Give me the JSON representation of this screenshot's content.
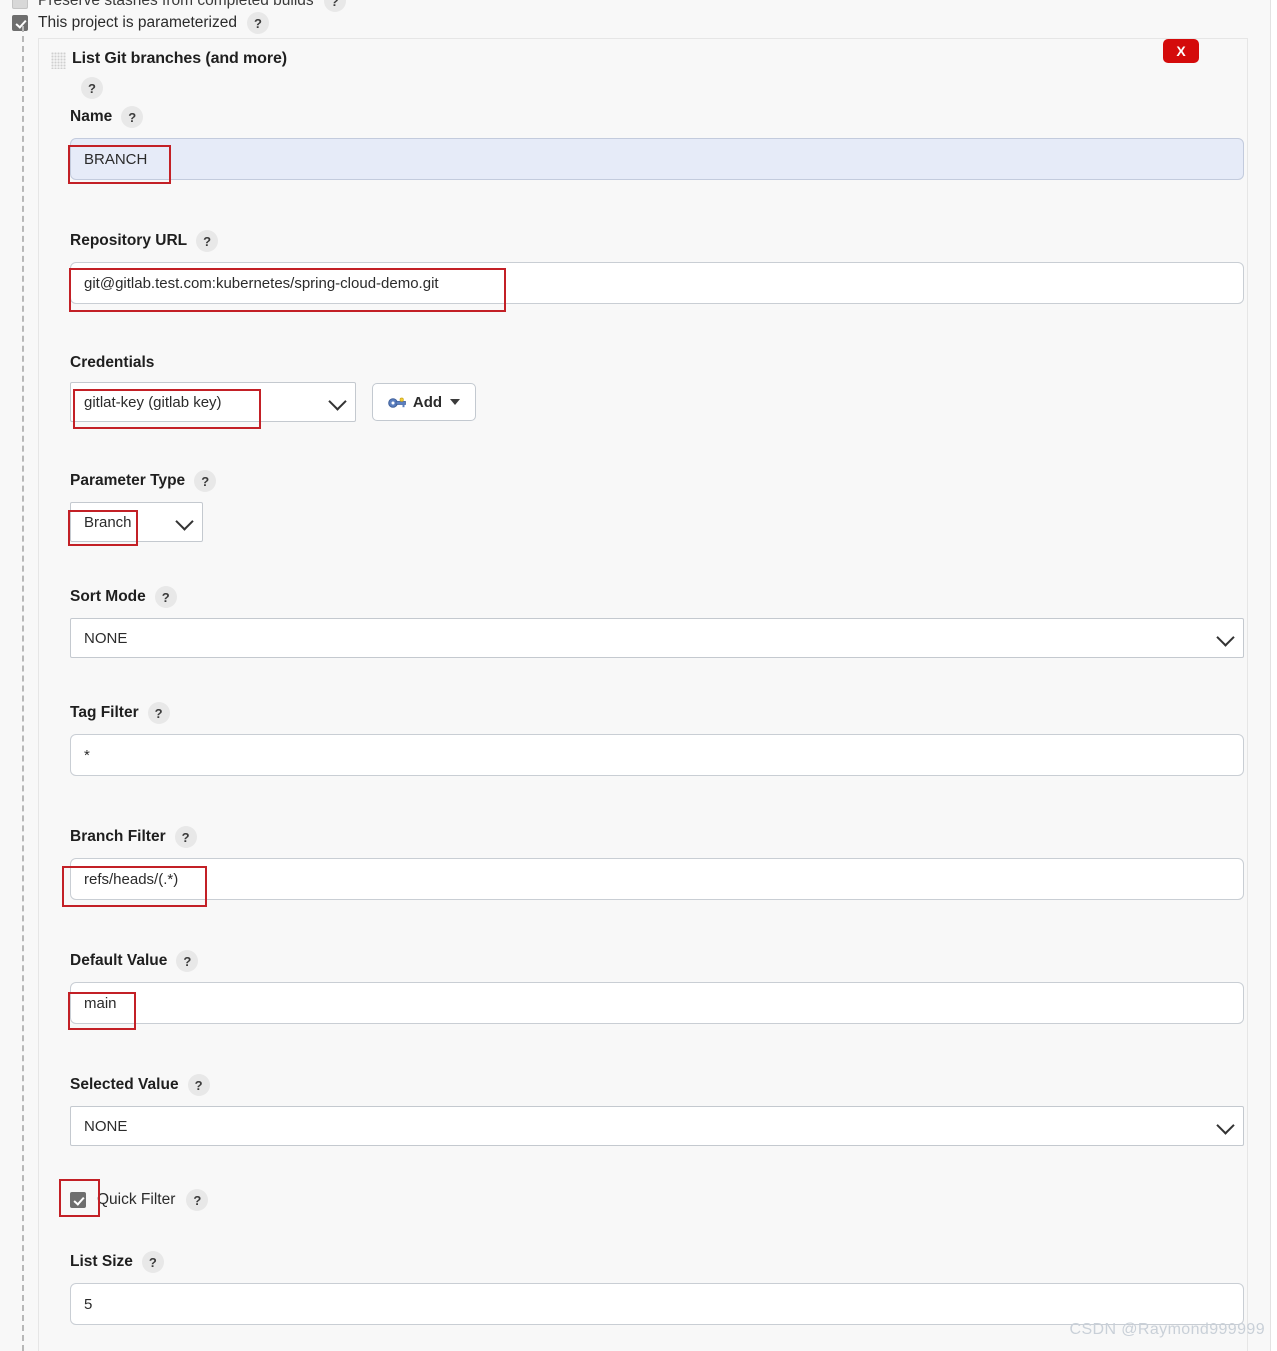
{
  "top": {
    "cut_row_label": "Preserve stashes from completed builds",
    "parameterized_label": "This project is parameterized",
    "help_glyph": "?"
  },
  "panel": {
    "title": "List Git branches (and more)",
    "delete_label": "X",
    "grip_icon": "drag-grip-icon"
  },
  "fields": {
    "name": {
      "label": "Name",
      "value": "BRANCH"
    },
    "repository_url": {
      "label": "Repository URL",
      "value": "git@gitlab.test.com:kubernetes/spring-cloud-demo.git"
    },
    "credentials": {
      "label": "Credentials",
      "value": "gitlat-key (gitlab key)",
      "add_label": "Add",
      "add_icon": "key-icon"
    },
    "parameter_type": {
      "label": "Parameter Type",
      "value": "Branch"
    },
    "sort_mode": {
      "label": "Sort Mode",
      "value": "NONE"
    },
    "tag_filter": {
      "label": "Tag Filter",
      "value": "*"
    },
    "branch_filter": {
      "label": "Branch Filter",
      "value": "refs/heads/(.*)"
    },
    "default_value": {
      "label": "Default Value",
      "value": "main"
    },
    "selected_value": {
      "label": "Selected Value",
      "value": "NONE"
    },
    "quick_filter": {
      "label": "Quick Filter",
      "checked": true
    },
    "list_size": {
      "label": "List Size",
      "value": "5"
    }
  },
  "watermark": "CSDN @Raymond999999",
  "colors": {
    "annotation": "#c32026",
    "delete_button": "#d40b0b",
    "highlight_field": "#e6ebf8",
    "page_background": "#f8f8f8"
  }
}
